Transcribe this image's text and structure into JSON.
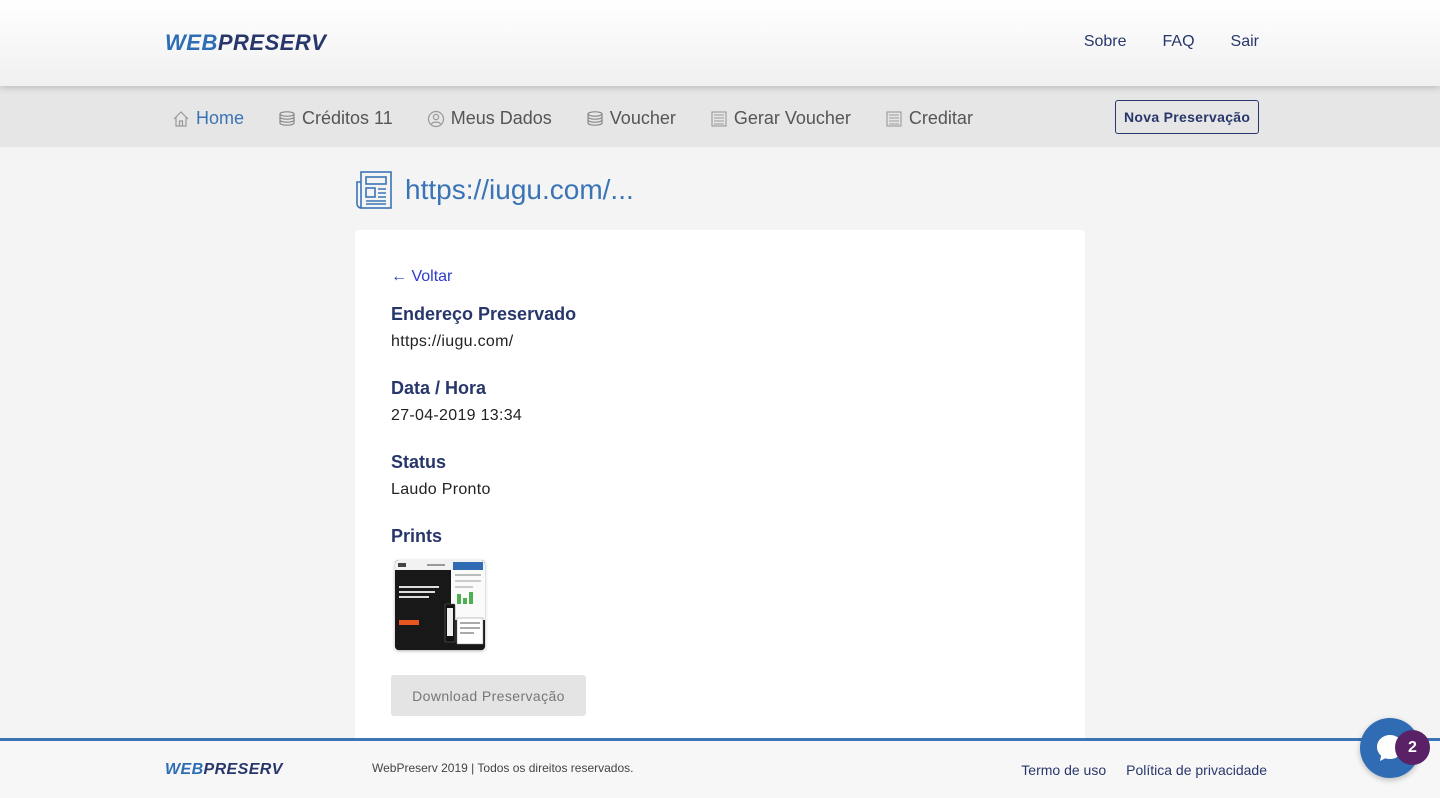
{
  "header": {
    "logo": {
      "part1": "WEB",
      "part2": "PRESERV"
    },
    "links": [
      {
        "label": "Sobre"
      },
      {
        "label": "FAQ"
      },
      {
        "label": "Sair"
      }
    ]
  },
  "nav": {
    "items": [
      {
        "label": "Home",
        "icon": "home-icon",
        "active": true
      },
      {
        "label": "Créditos 11",
        "icon": "coins-icon"
      },
      {
        "label": "Meus Dados",
        "icon": "user-icon"
      },
      {
        "label": "Voucher",
        "icon": "coins-icon"
      },
      {
        "label": "Gerar Voucher",
        "icon": "document-icon"
      },
      {
        "label": "Creditar",
        "icon": "document-icon"
      }
    ],
    "new_button": "Nova Preservação"
  },
  "page": {
    "title": "https://iugu.com/...",
    "back": "← Voltar",
    "fields": [
      {
        "label": "Endereço Preservado",
        "value": "https://iugu.com/"
      },
      {
        "label": "Data / Hora",
        "value": "27-04-2019 13:34"
      },
      {
        "label": "Status",
        "value": "Laudo Pronto"
      }
    ],
    "prints_label": "Prints",
    "download_button": "Download Preservação"
  },
  "footer": {
    "logo": {
      "part1": "WEB",
      "part2": "PRESERV"
    },
    "copyright": "WebPreserv 2019 | Todos os direitos reservados.",
    "links": [
      {
        "label": "Termo de uso"
      },
      {
        "label": "Política de privacidade"
      }
    ]
  },
  "chat": {
    "badge": "2"
  },
  "colors": {
    "primary": "#3b74b6",
    "navy": "#28376b",
    "link": "#2c3bd1",
    "chat": "#2f6cb3",
    "badge": "#5a2167"
  }
}
